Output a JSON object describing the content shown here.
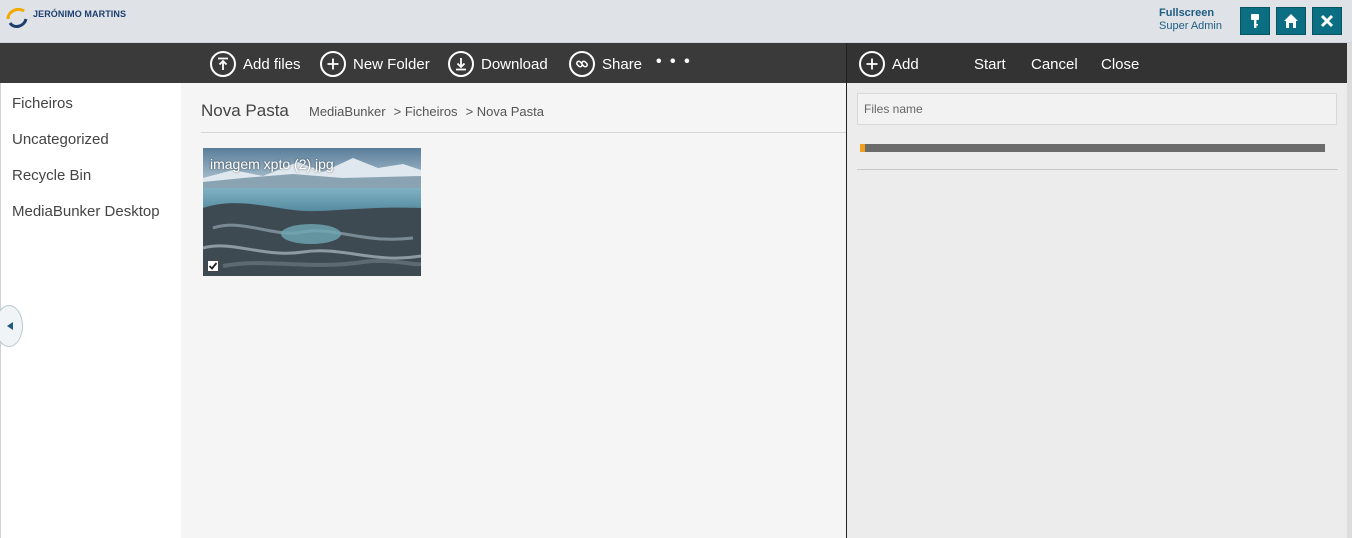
{
  "header": {
    "logo_text": "JERÓNIMO MARTINS",
    "fullscreen_label": "Fullscreen",
    "user_role": "Super Admin",
    "buttons": [
      "key-icon",
      "home-icon",
      "close-icon"
    ],
    "accent_color": "#0c6e82"
  },
  "toolbar": {
    "add_files": "Add files",
    "new_folder": "New Folder",
    "download": "Download",
    "share": "Share",
    "more": "• • •"
  },
  "upload_toolbar": {
    "add": "Add",
    "start": "Start",
    "cancel": "Cancel",
    "close": "Close"
  },
  "sidebar": {
    "items": [
      {
        "label": "Ficheiros"
      },
      {
        "label": "Uncategorized"
      },
      {
        "label": "Recycle Bin"
      },
      {
        "label": "MediaBunker Desktop"
      }
    ]
  },
  "main": {
    "title": "Nova Pasta",
    "breadcrumb": [
      "MediaBunker",
      "> Ficheiros",
      "> Nova Pasta"
    ],
    "files": [
      {
        "name": "imagem xpto (2).jpg",
        "selected": true
      }
    ]
  },
  "upload_panel": {
    "files_name_placeholder": "Files name",
    "progress_fraction": 0.01,
    "progress_color": "#f0a020"
  }
}
